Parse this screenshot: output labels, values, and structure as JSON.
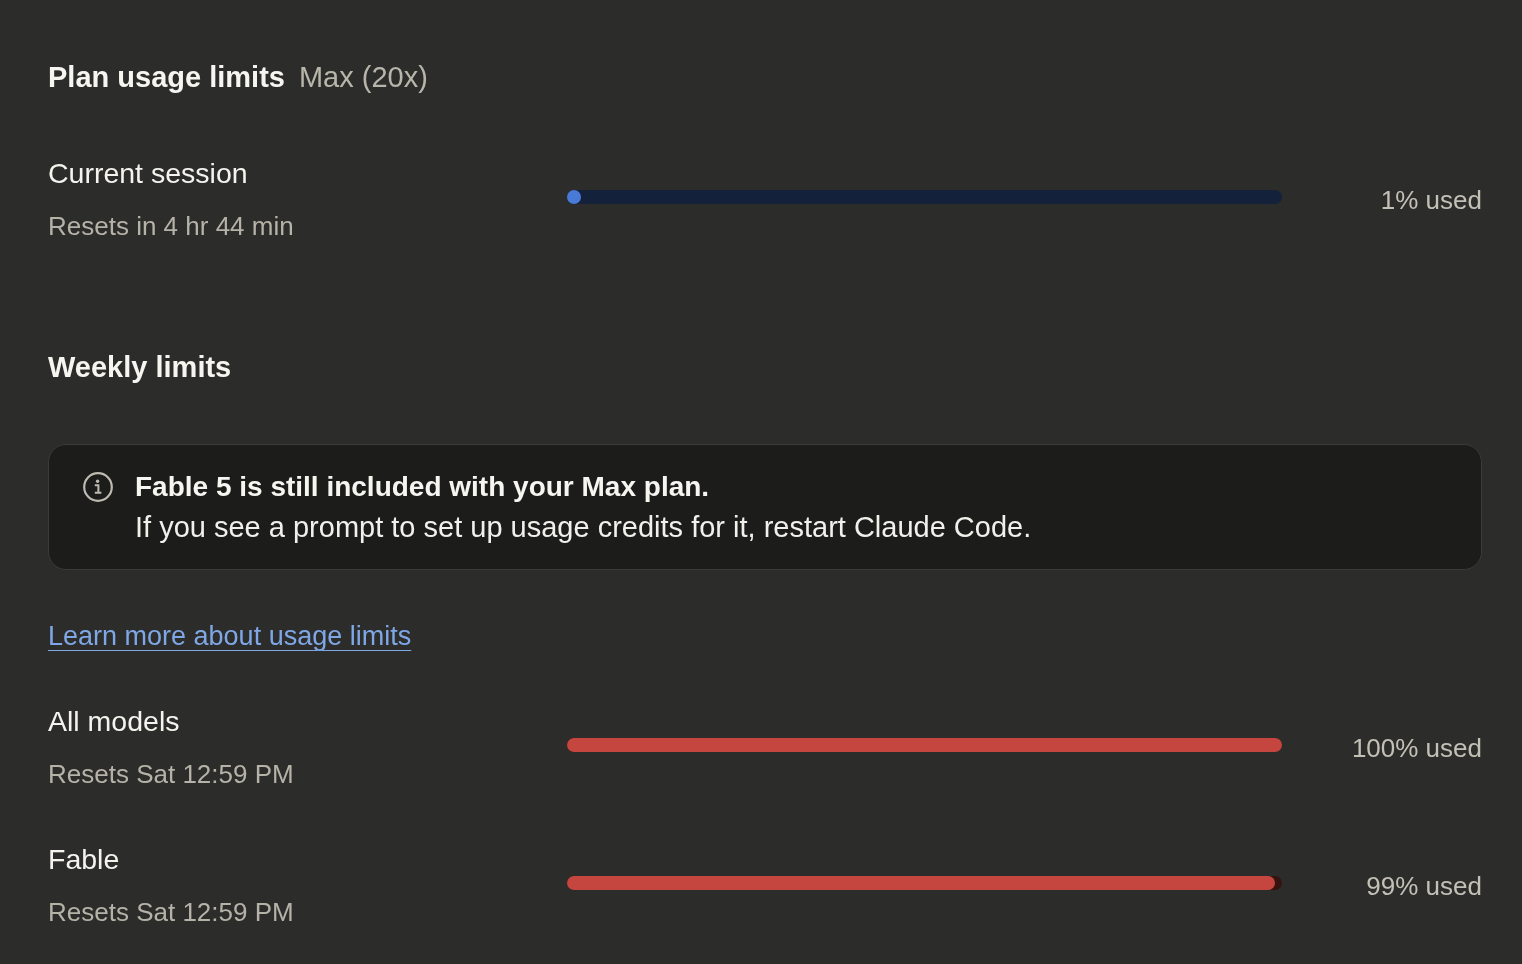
{
  "plan_usage": {
    "title": "Plan usage limits",
    "plan": "Max (20x)"
  },
  "current_session": {
    "name": "Current session",
    "resets": "Resets in 4 hr 44 min",
    "color": "#4a7ad8",
    "level": 0.01,
    "reading": "1% used"
  },
  "weekly_limits": {
    "title": "Weekly limits",
    "notice": {
      "heading": "Fable 5 is still included with your Max plan.",
      "body": "If you see a prompt to set up usage credits for it, restart Claude Code."
    },
    "link": "Learn more about usage limits",
    "limits": [
      {
        "name": "All models",
        "resets": "Resets Sat 12:59 PM",
        "color": "#c4463f",
        "level": 1.0,
        "reading": "100% used"
      },
      {
        "name": "Fable",
        "resets": "Resets Sat 12:59 PM",
        "color": "#c4463f",
        "level": 0.99,
        "reading": "99% used"
      }
    ]
  }
}
